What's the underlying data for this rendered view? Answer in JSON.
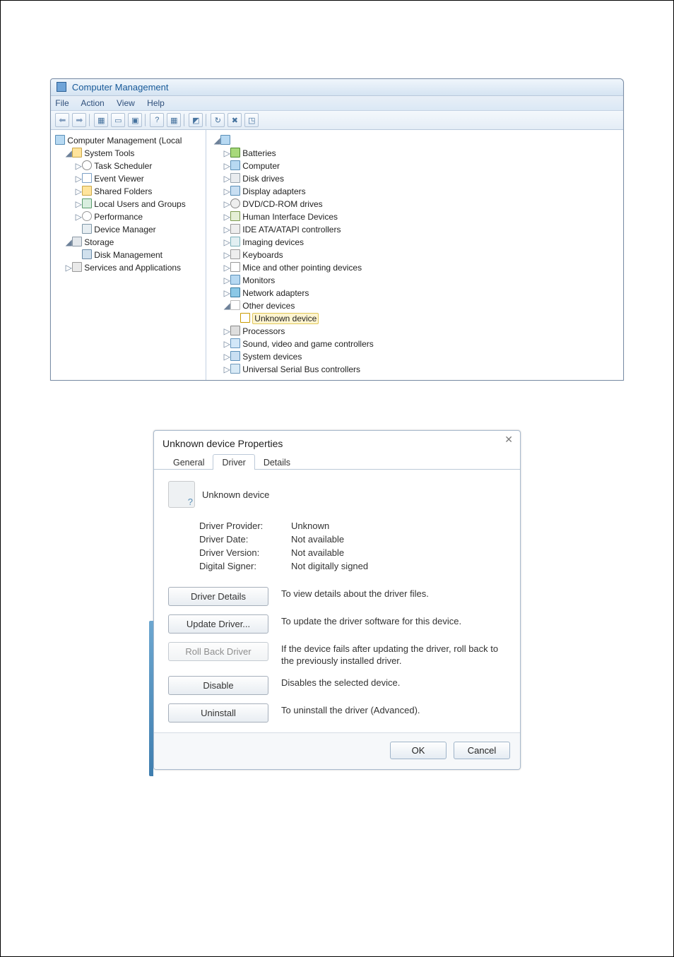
{
  "cm": {
    "title": "Computer Management",
    "menu": {
      "file": "File",
      "action": "Action",
      "view": "View",
      "help": "Help"
    },
    "left": {
      "root": "Computer Management (Local",
      "system_tools": "System Tools",
      "task_scheduler": "Task Scheduler",
      "event_viewer": "Event Viewer",
      "shared_folders": "Shared Folders",
      "local_users": "Local Users and Groups",
      "performance": "Performance",
      "device_manager": "Device Manager",
      "storage": "Storage",
      "disk_mgmt": "Disk Management",
      "services": "Services and Applications"
    },
    "right": {
      "batteries": "Batteries",
      "computer": "Computer",
      "disk_drives": "Disk drives",
      "display_adapters": "Display adapters",
      "dvd": "DVD/CD-ROM drives",
      "hid": "Human Interface Devices",
      "ide": "IDE ATA/ATAPI controllers",
      "imaging": "Imaging devices",
      "keyboards": "Keyboards",
      "mice": "Mice and other pointing devices",
      "monitors": "Monitors",
      "network": "Network adapters",
      "other": "Other devices",
      "unknown": "Unknown device",
      "processors": "Processors",
      "sound": "Sound, video and game controllers",
      "system": "System devices",
      "usb": "Universal Serial Bus controllers"
    }
  },
  "dlg": {
    "title": "Unknown device Properties",
    "tabs": {
      "general": "General",
      "driver": "Driver",
      "details": "Details"
    },
    "device_name": "Unknown device",
    "rows": {
      "provider_k": "Driver Provider:",
      "provider_v": "Unknown",
      "date_k": "Driver Date:",
      "date_v": "Not available",
      "version_k": "Driver Version:",
      "version_v": "Not available",
      "signer_k": "Digital Signer:",
      "signer_v": "Not digitally signed"
    },
    "buttons": {
      "details": {
        "label": "Driver Details",
        "desc": "To view details about the driver files."
      },
      "update": {
        "label": "Update Driver...",
        "desc": "To update the driver software for this device."
      },
      "rollback": {
        "label": "Roll Back Driver",
        "desc": "If the device fails after updating the driver, roll back to the previously installed driver."
      },
      "disable": {
        "label": "Disable",
        "desc": "Disables the selected device."
      },
      "uninstall": {
        "label": "Uninstall",
        "desc": "To uninstall the driver (Advanced)."
      }
    },
    "ok": "OK",
    "cancel": "Cancel"
  }
}
